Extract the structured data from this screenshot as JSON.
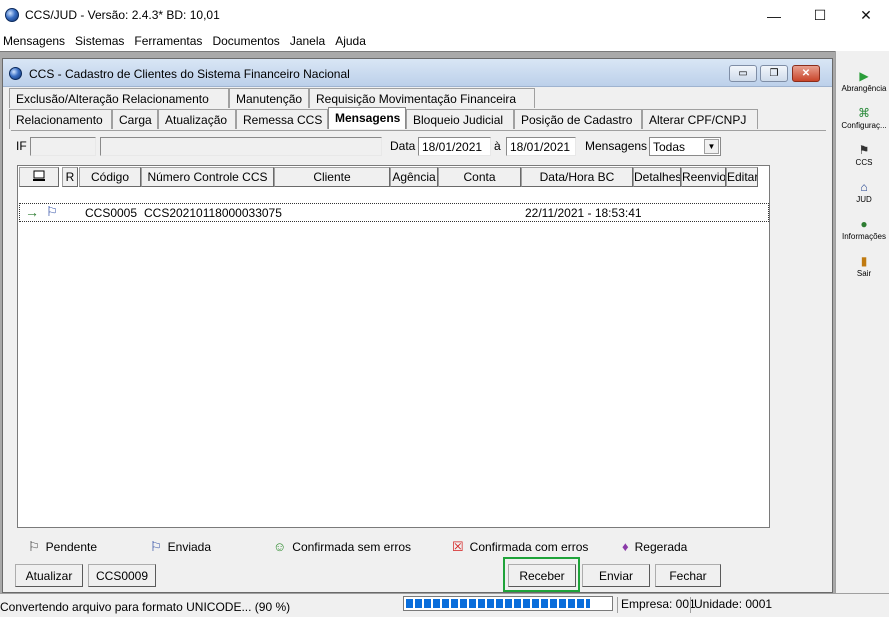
{
  "window": {
    "title": "CCS/JUD - Versão: 2.4.3* BD: 10,01",
    "min": "—",
    "max": "☐",
    "close": "✕"
  },
  "menu": [
    "Mensagens",
    "Sistemas",
    "Ferramentas",
    "Documentos",
    "Janela",
    "Ajuda"
  ],
  "right_toolbar": [
    {
      "label": "Abrangência",
      "icon": "▶",
      "color": "#2a9d3a",
      "name": "abrangencia"
    },
    {
      "label": "Configuraç...",
      "icon": "⌘",
      "color": "#2a8a3a",
      "name": "configuracoes"
    },
    {
      "label": "CCS",
      "icon": "⚑",
      "color": "#333333",
      "name": "ccs"
    },
    {
      "label": "JUD",
      "icon": "⌂",
      "color": "#1b3c8c",
      "name": "jud"
    },
    {
      "label": "Informações",
      "icon": "●",
      "color": "#2e7d32",
      "name": "informacoes"
    },
    {
      "label": "Sair",
      "icon": "▮",
      "color": "#c07a10",
      "name": "sair"
    }
  ],
  "child_window": {
    "title": "CCS - Cadastro de Clientes do Sistema Financeiro Nacional",
    "min": "▭",
    "restore": "❐",
    "close": "✕"
  },
  "tabs_row1": [
    "Exclusão/Alteração Relacionamento",
    "Manutenção",
    "Requisição Movimentação Financeira"
  ],
  "tabs_row2": [
    "Relacionamento",
    "Carga",
    "Atualização",
    "Remessa CCS",
    "Mensagens",
    "Bloqueio Judicial",
    "Posição de Cadastro",
    "Alterar CPF/CNPJ"
  ],
  "filter": {
    "if_label": "IF",
    "if_value": "",
    "if_desc": "",
    "data_label": "Data",
    "date_from": "18/01/2021",
    "a_label": "à",
    "date_to": "18/01/2021",
    "mensagens_label": "Mensagens",
    "mensagens_value": "Todas"
  },
  "grid": {
    "headers": [
      "",
      "R",
      "Código",
      "Número Controle CCS",
      "Cliente",
      "Agência",
      "Conta",
      "Data/Hora BC",
      "Detalhes",
      "Reenvio",
      "Editar"
    ],
    "rows": [
      {
        "codigo": "CCS0005",
        "numero": "CCS20210118000033075",
        "data_hora": "22/11/2021 - 18:53:41"
      }
    ]
  },
  "legend": [
    {
      "label": "Pendente",
      "icon": "⚐",
      "color": "#333333",
      "name": "pendente"
    },
    {
      "label": "Enviada",
      "icon": "⚐",
      "color": "#1b3c9c",
      "name": "enviada"
    },
    {
      "label": "Confirmada sem erros",
      "icon": "☺",
      "color": "#2e8b2e",
      "name": "confirmada-sem-erros"
    },
    {
      "label": "Confirmada com erros",
      "icon": "☒",
      "color": "#d42020",
      "name": "confirmada-com-erros"
    },
    {
      "label": "Regerada",
      "icon": "♦",
      "color": "#8a3aa8",
      "name": "regerada"
    }
  ],
  "buttons": {
    "atualizar": "Atualizar",
    "ccs0009": "CCS0009",
    "receber": "Receber",
    "enviar": "Enviar",
    "fechar": "Fechar"
  },
  "status": {
    "message": "Convertendo arquivo para formato UNICODE... (90 %)",
    "progress": 0.9,
    "empresa": "Empresa: 001",
    "unidade": "Unidade: 0001"
  }
}
